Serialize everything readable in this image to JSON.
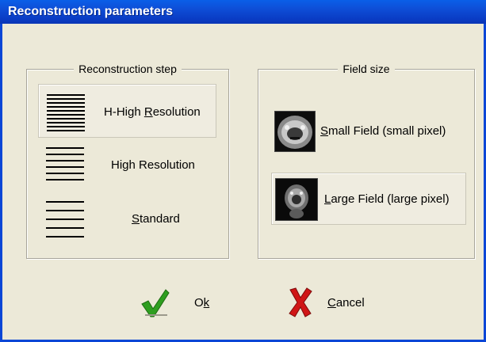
{
  "window": {
    "title": "Reconstruction parameters"
  },
  "reconstruction_step": {
    "legend": "Reconstruction step",
    "options": [
      {
        "pre": "H-High ",
        "mn": "R",
        "post": "esolution",
        "icon": "lines-dense-icon",
        "selected": true
      },
      {
        "pre": "High Resolution",
        "mn": "",
        "post": "",
        "icon": "lines-medium-icon",
        "selected": false
      },
      {
        "pre": "",
        "mn": "S",
        "post": "tandard",
        "icon": "lines-sparse-icon",
        "selected": false
      }
    ]
  },
  "field_size": {
    "legend": "Field size",
    "options": [
      {
        "pre": "",
        "mn": "S",
        "post": "mall Field (small pixel)",
        "icon": "ct-scan-small-field-icon",
        "selected": false
      },
      {
        "pre": "",
        "mn": "L",
        "post": "arge Field (large pixel)",
        "icon": "ct-scan-large-field-icon",
        "selected": true
      }
    ]
  },
  "buttons": {
    "ok": {
      "pre": "O",
      "mn": "k",
      "post": "",
      "icon": "green-checkmark-icon"
    },
    "cancel": {
      "pre": "",
      "mn": "C",
      "post": "ancel",
      "icon": "red-x-icon"
    }
  },
  "colors": {
    "titlebar": "#0a46d6",
    "dialog_bg": "#ece9d8",
    "ok_icon": "#2e9e1f",
    "cancel_icon": "#d01616"
  }
}
